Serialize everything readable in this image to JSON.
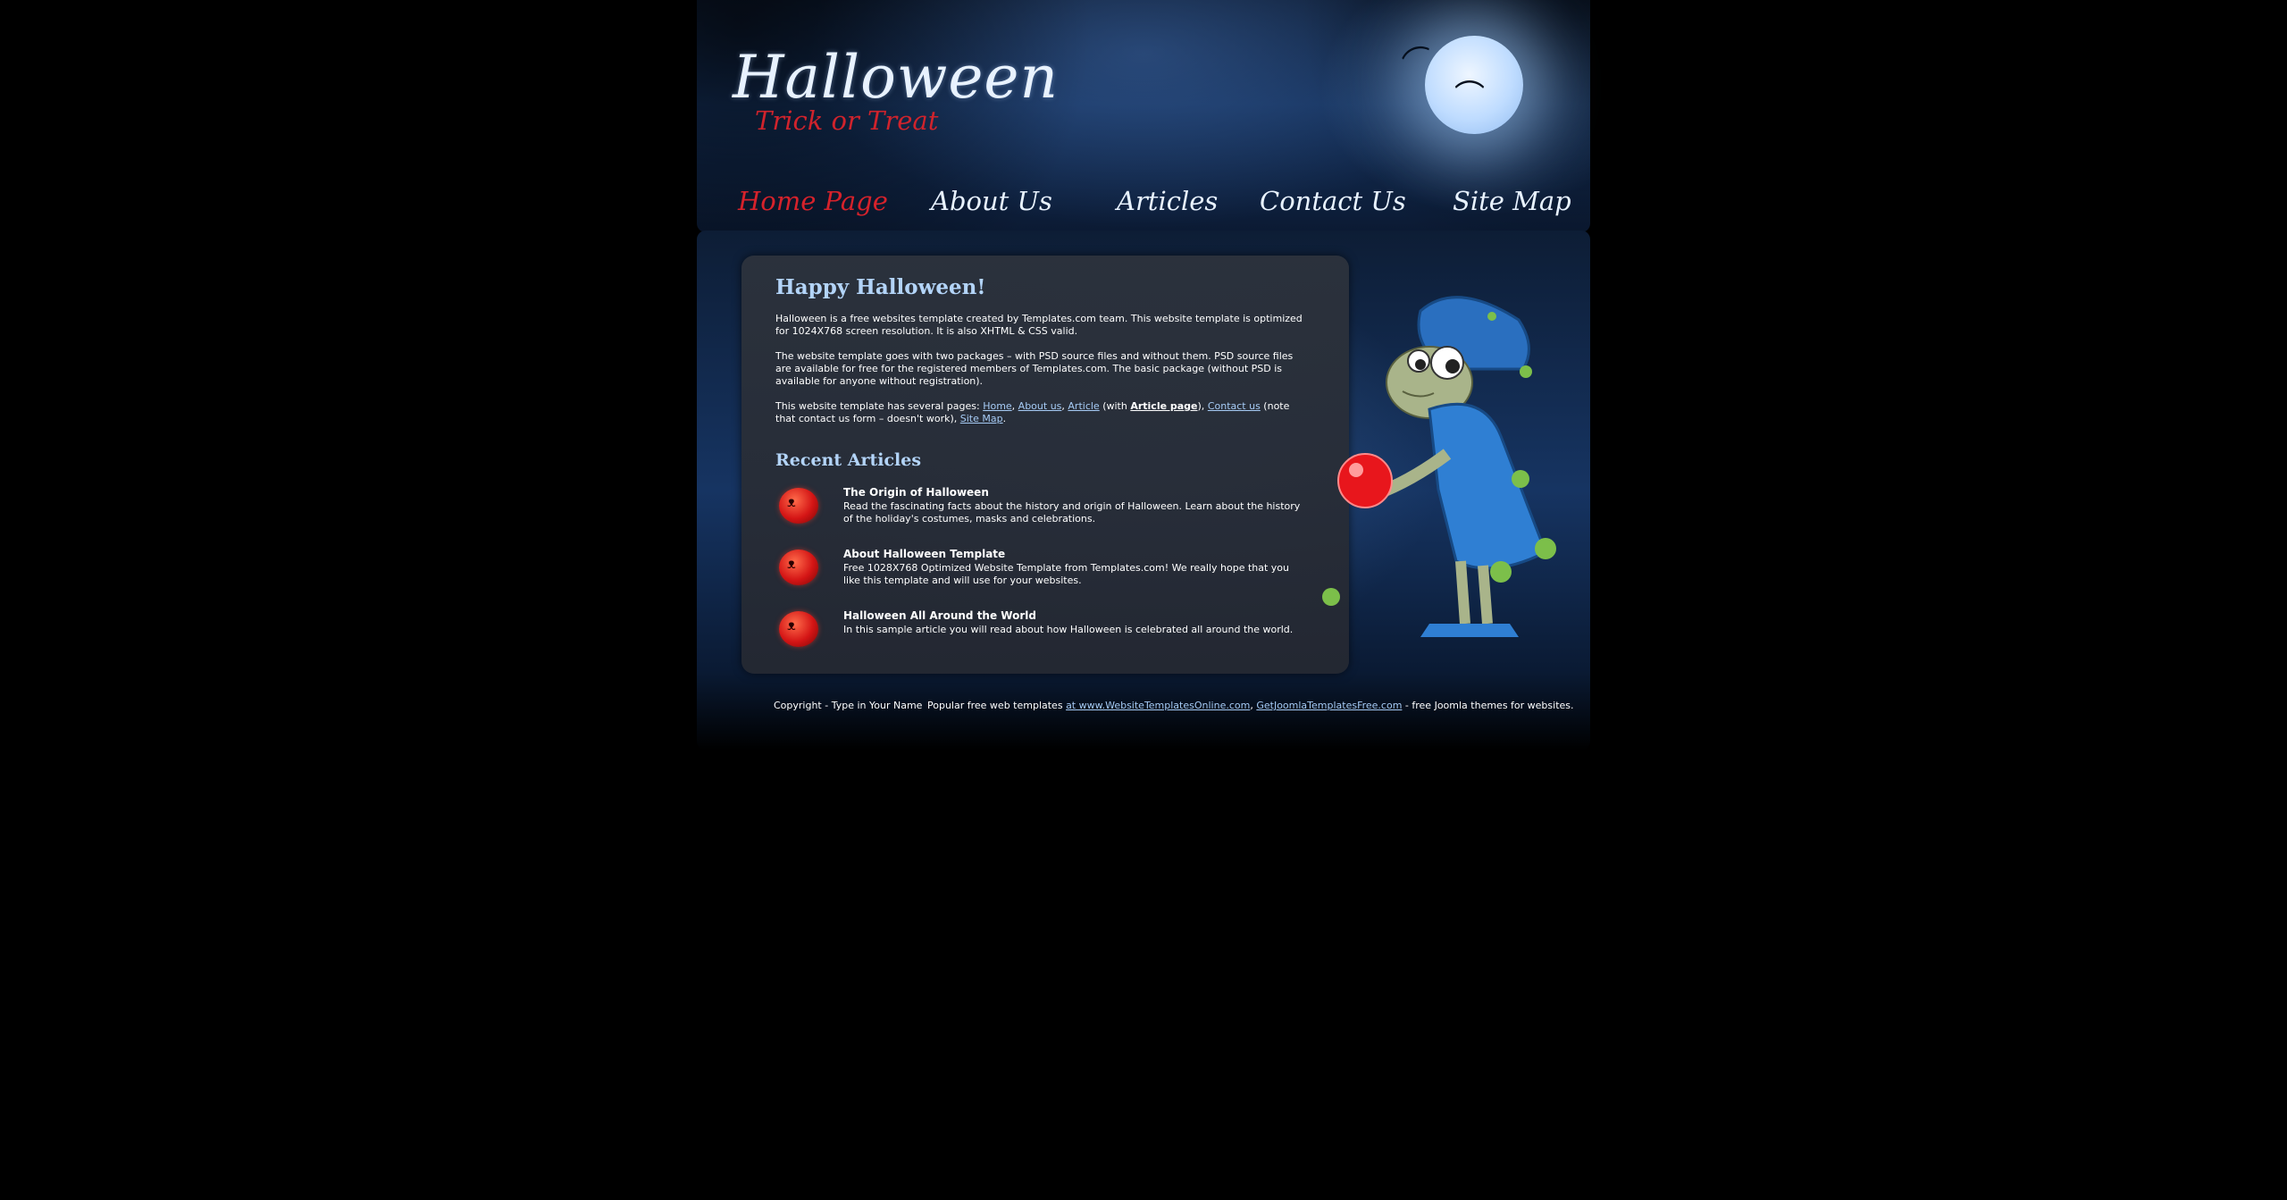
{
  "header": {
    "logo_title": "Halloween",
    "logo_subtitle": "Trick or Treat",
    "bat_glyph": "⌒"
  },
  "nav": {
    "items": [
      {
        "label": "Home Page",
        "active": true
      },
      {
        "label": "About Us",
        "active": false
      },
      {
        "label": "Articles",
        "active": false
      },
      {
        "label": "Contact Us",
        "active": false
      },
      {
        "label": "Site Map",
        "active": false
      }
    ]
  },
  "main": {
    "heading": "Happy Halloween!",
    "para1": "Halloween is a free websites template created by Templates.com team. This website template is optimized for 1024X768 screen resolution. It is also XHTML & CSS valid.",
    "para2": "The website template goes with two packages – with PSD source files and without them. PSD source files are available for free for the registered members of Templates.com. The basic package (without PSD is available for anyone without registration).",
    "para3": {
      "intro": "This website template has several pages: ",
      "link_home": "Home",
      "sep1": ", ",
      "link_about": "About us",
      "sep2": ", ",
      "link_article": "Article",
      "with": " (with ",
      "article_page": "Article page",
      "close": "), ",
      "link_contact": "Contact us",
      "note": " (note that contact us form – doesn't work), ",
      "link_sitemap": "Site Map",
      "end": "."
    },
    "recent_heading": "Recent Articles",
    "articles": [
      {
        "title": "The Origin of Halloween",
        "text": "Read the fascinating facts about the history and origin of Halloween. Learn about the history of the holiday's costumes, masks and celebrations."
      },
      {
        "title": "About Halloween Template",
        "text": "Free 1028X768 Optimized Website Template from Templates.com! We really hope that you like this template and will use for your websites."
      },
      {
        "title": "Halloween All Around the World",
        "text": "In this sample article you will read about how Halloween is celebrated all around the world."
      }
    ],
    "pumpkin_glyph": "ᴥ"
  },
  "footer": {
    "copyright": "Copyright - Type in Your Name",
    "popular": "Popular free web templates ",
    "link1": "at www.WebsiteTemplatesOnline.com",
    "sep": ", ",
    "link2": "GetJoomlaTemplatesFree.com",
    "tail": " - free Joomla themes for websites."
  },
  "colors": {
    "accent": "#d6222b",
    "heading": "#b3d4f8",
    "link": "#a6cbf5",
    "background": "#000000"
  }
}
